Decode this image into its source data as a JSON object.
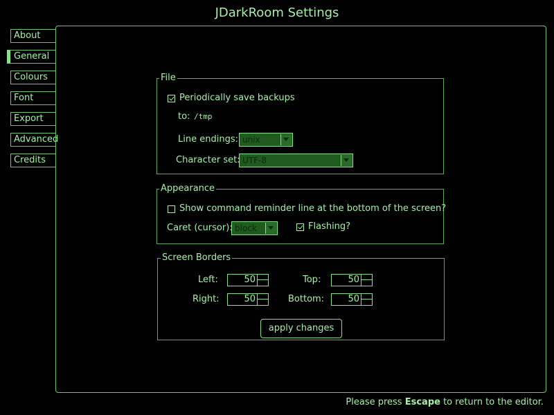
{
  "window": {
    "title": "JDarkRoom Settings"
  },
  "sidebar": {
    "items": [
      {
        "label": "About"
      },
      {
        "label": "General"
      },
      {
        "label": "Colours"
      },
      {
        "label": "Font"
      },
      {
        "label": "Export"
      },
      {
        "label": "Advanced"
      },
      {
        "label": "Credits"
      }
    ],
    "active": "General"
  },
  "file": {
    "legend": "File",
    "periodic_backup_label": "Periodically save backups",
    "periodic_backup_checked": true,
    "to_label": "to:",
    "backup_path": "/tmp",
    "line_endings_label": "Line endings:",
    "line_endings_value": "unix",
    "charset_label": "Character set:",
    "charset_value": "UTF-8"
  },
  "appearance": {
    "legend": "Appearance",
    "reminder_label": "Show command reminder line at the bottom of the screen?",
    "reminder_checked": false,
    "caret_label": "Caret (cursor):",
    "caret_value": "block",
    "flashing_label": "Flashing?",
    "flashing_checked": true
  },
  "borders": {
    "legend": "Screen Borders",
    "left_label": "Left:",
    "left_value": "50",
    "top_label": "Top:",
    "top_value": "50",
    "right_label": "Right:",
    "right_value": "50",
    "bottom_label": "Bottom:",
    "bottom_value": "50"
  },
  "apply_button": "apply changes",
  "footer": {
    "before": "Please press ",
    "key": "Escape",
    "after": " to return to the editor."
  },
  "colors": {
    "background": "#000000",
    "foreground": "#a6f0a6",
    "border": "#73c473",
    "select_fill": "#1f5a1f"
  }
}
